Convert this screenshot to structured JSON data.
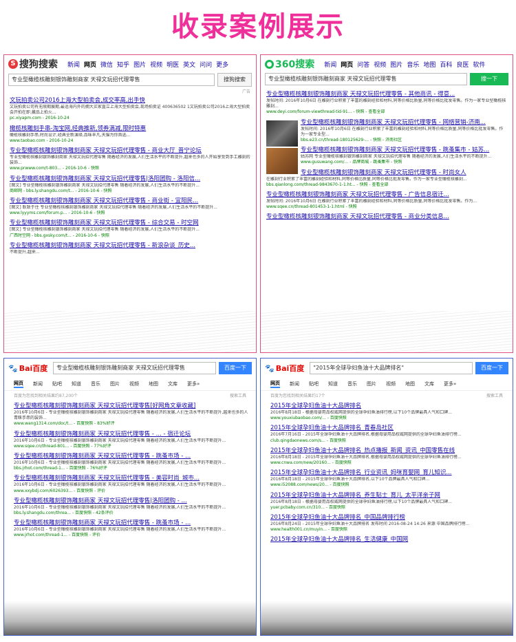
{
  "heading": "收录案例展示",
  "sogou": {
    "logo_text": "搜狗搜索",
    "nav": [
      "新闻",
      "网页",
      "微信",
      "知乎",
      "图片",
      "视频",
      "明医",
      "英文",
      "问问",
      "更多"
    ],
    "query": "专业型橄榄核雕刻银饰雕刻商家 天禄文玩招代理零售",
    "button": "搜狗搜索",
    "ad_tag": "广告",
    "results": [
      {
        "title": "文玩拍卖公司2016上海大型拍卖会,成交率高,出手快",
        "desc": "文玩拍卖公司有无限期展期,最适海内外的拥大买家直立上海大型拍卖会,现场拍卖证 400636502 1文玩拍卖公司2016上海大型拍卖会开拍在即,藏品上拍火...",
        "url": "pc.xiyapm.com - 2016-10-24"
      },
      {
        "title": "橄榄核雕刻手串-淘宝网,经典推新,领券满减,限时特惠",
        "desc": "橄榄核雕刻手串,时尚设计,经典全新演绎,品味丰凡,天猫为你首选...",
        "url": "www.taobao.com - 2016-10-24"
      },
      {
        "title": "专业型橄榄核雕刻银饰雕刻商家 天禄文玩招代理零售 - 商业大厅_普宁论坛",
        "desc": "专业型橄榄核雕刻银饰雕刻商家 天禄文玩招代理零售 随着经济的发展,人们生活水平的不断提升,越来也多的人开始享受到手工雕刻的装饰...",
        "url": "www.prwww.com/t-803... - 2016-10-6 - 快照"
      },
      {
        "title": "专业型橄榄核雕刻银饰雕刻商家 天禄文玩招代理零售|洛阳团购 - 洛阳信...",
        "desc": "[图文] 专业型橄榄核雕刻银饰雕刻商家 天禄文玩招代理零售 随着经济的发展,人们生活水平的不断提升...",
        "url": "商邮网 - bbs.ly.shangdu.com/t... - 2016-10-6 - 快照"
      },
      {
        "title": "专业型橄榄核雕刻银饰雕刻商家 天禄文玩招代理零售 - 商业街 - 宜阳民...",
        "desc": "[图文] 耿致于住 专业型橄榄核雕刻银饰雕刻商家 天禄文玩招代理零售 随着经济的发展,人们生活水平的不断提升...",
        "url": "www.lyyyms.com/forum.p... - 2016-10-6 - 快照"
      },
      {
        "title": "专业型橄榄核雕刻银饰雕刻商家 天禄文玩招代理零售 - 综合交易 - 时空网",
        "desc": "[图文] 专业型橄榄核雕刻银饰雕刻商家 天禄文玩招代理零售 随着经济的发展,人们生活水平的不断提升...",
        "url": "广西时空网 - bbs.gxsky.com/t... - 2016-10-6 - 快照"
      },
      {
        "title": "专业型橄榄核雕刻银饰雕刻商家 天禄文玩招代理零售 - 新浪杂谈_历史...",
        "desc": "不断提升,越来...",
        "url": ""
      }
    ]
  },
  "so360": {
    "logo_text": "360搜索",
    "nav": [
      "新闻",
      "网页",
      "问答",
      "视频",
      "图片",
      "音乐",
      "地图",
      "百科",
      "良医",
      "软件"
    ],
    "query": "专业型橄榄核雕刻银饰雕刻商家 天禄文玩招代理零售",
    "button": "搜一下",
    "results": [
      {
        "title": "专业型橄榄核雕刻银饰雕刻商家 天禄文玩招代理零售 - 其他商讯 - 得意...",
        "desc": "发帖时间: 2016年10月6日 在雕刻行业积累了丰富的雕刻经验和材料,同等价格比质量,同等价格比批发零售。作为一家专业型橄榄核雕刻...",
        "url": "www.deyi.com/forum-viewthread-tid-91... - 快照 - 查看全部"
      },
      {
        "title": "专业型橄榄核雕刻银饰雕刻商家 天禄文玩招代理零售 - 网络营销-济南...",
        "desc": "发帖时间: 2016年10月6日 在雕刻行业积累了丰富的雕刻经验和材料,同等价格比质量,同等价格比批发零售。作为一家专业型...",
        "url": "bbs.e23.cn/thread-180125629-... - 快照 - 济南社区"
      },
      {
        "title": "专业型橄榄核雕刻银饰雕刻商家 天禄文玩招代理零售 - 跳蚤集市 - 姑苏...",
        "desc": "姑苏网 专业型橄榄核雕刻银饰雕刻商家 天禄文玩招代理零售 随着经济的发展,人们生活水平的不断提升...",
        "url": "www.gusuwang.com/... - 品牌商城 - 跳蚤集市 - 快照"
      },
      {
        "title": "专业型橄榄核雕刻银饰雕刻商家 天禄文玩招代理零售 - 时尚女人",
        "desc": "在雕刻行业积累了丰富的雕刻经验和材料,同等价格比质量,同等价格比批发零售。作为一家专业型橄榄核雕刻...",
        "url": "bbs.qianlong.com/thread-9843670-1-1.ht... - 快照 - 查看全部"
      },
      {
        "title": "专业型橄榄核雕刻银饰雕刻商家 天禄文玩招代理零售 - 广告信息宿迁...",
        "desc": "发帖时间: 2016年10月6日 在雕刻行业积累了丰富的雕刻经验和材料,同等价格比质量,同等价格比批发零售。作为...",
        "url": "www.sqee.cn/thread-801453-1-1.html - 快照"
      },
      {
        "title": "专业型橄榄核雕刻银饰雕刻商家 天禄文玩招代理零售 - 商业分类信息...",
        "desc": "",
        "url": ""
      }
    ]
  },
  "baidu1": {
    "logo_text": "Bai百度",
    "query": "专业型橄榄核雕刻银饰雕刻商家 天禄文玩招代理零售",
    "button": "百度一下",
    "tabs": [
      "网页",
      "新闻",
      "贴吧",
      "知道",
      "音乐",
      "图片",
      "视频",
      "地图",
      "文库",
      "更多»"
    ],
    "stats": "百度为您找到相关结果约87,200个",
    "tool": "搜索工具",
    "results": [
      {
        "title": "专业型橄榄核雕刻银饰雕刻商家 天禄文玩招代理零售[好网角文章收藏]",
        "desc": "2016年10月6日 - 专业型橄榄核雕刻银饰雕刻商家 天禄文玩招代理零售 随着经济的发展,人们生活水平的不断提升,越来也多的人青睐手串的装饰...",
        "url": "www.wang1314.com/doc/t... - 百度快照 - 83%好评"
      },
      {
        "title": "专业型橄榄核雕刻银饰雕刻商家 天禄文玩招代理零售 - ... - 宿迁论坛",
        "desc": "2016年10月6日 - 专业型橄榄核雕刻银饰雕刻商家 天禄文玩招代理零售 随着经济的发展,人们生活水平的不断提升...",
        "url": "www.sqee.cn/thread-801... - 百度快照 - 77%好评"
      },
      {
        "title": "专业型橄榄核雕刻银饰雕刻商家 天禄文玩招代理零售 - 跳蚤市场 - ...",
        "desc": "2016年10月6日 - 专业型橄榄核雕刻银饰雕刻商家 天禄文玩招代理零售 随着经济的发展,人们生活水平的不断提升...",
        "url": "bbs.jrhot.com/thread-1... - 百度快照 - 76%好评"
      },
      {
        "title": "专业型橄榄核雕刻银饰雕刻商家 天禄文玩招代理零售 - 美容时尚_城市...",
        "desc": "2016年10月6日 - 专业型橄榄核雕刻银饰雕刻商家 天禄文玩招代理零售 随着经济的发展,人们生活水平的不断提升...",
        "url": "www.xxybdj.com/6026393... - 百度快照 - 评价"
      },
      {
        "title": "专业型橄榄核雕刻银饰雕刻商家 天禄文玩招代理零售|洛阳团购 - ...",
        "desc": "2016年10月6日 - 专业型橄榄核雕刻银饰雕刻商家 天禄文玩招代理零售 随着经济的发展,人们生活水平的不断提升...",
        "url": "bbs.ly.shangdu.com/threa... - 百度快照 - 42条评价"
      },
      {
        "title": "专业型橄榄核雕刻银饰雕刻商家 天禄文玩招代理零售 - 跳蚤市场 - ...",
        "desc": "2016年10月6日 - 专业型橄榄核雕刻银饰雕刻商家 天禄文玩招代理零售 随着经济的发展,人们生活水平的不断提升...",
        "url": "www.jrhot.com/thread-1... - 百度快照 - 评价"
      }
    ]
  },
  "baidu2": {
    "logo_text": "Bai百度",
    "query": "\"2015年全球孕妇鱼油十大品牌排名\"",
    "button": "百度一下",
    "tabs": [
      "网页",
      "新闻",
      "贴吧",
      "知道",
      "音乐",
      "图片",
      "视频",
      "地图",
      "文库",
      "更多»"
    ],
    "stats": "百度为您找到相关结果约17个",
    "tool": "搜索工具",
    "results": [
      {
        "title": "2015年全球孕妇鱼油十大品牌排名",
        "desc": "2016年8月18日 - 根据母婴用品权威网提供的全球孕妇鱼油排行榜,以下10个品牌最具人气和口碑...",
        "url": "www.youxiubaobao.com/... - 百度快照"
      },
      {
        "title": "2015年全球孕妇鱼油十大品牌排名_青春岛社区",
        "desc": "2016年7月16日 - 2015年全球孕妇鱼油十大品牌排名,根据母婴用品权威网提供的全球孕妇鱼油排行榜...",
        "url": "club.qingdaonews.com/s... - 百度快照"
      },
      {
        "title": "2015年全球孕妇鱼油十大品牌排名_热点播报_新闻_资讯_中国零售在线",
        "desc": "2016年8月18日 - 2015年全球孕妇鱼油十大品牌排名,根据母婴用品权威网提供的全球孕妇鱼油排行榜...",
        "url": "www.cnwa.com/new/20160... - 百度快照"
      },
      {
        "title": "2015年全球孕妇鱼油十大品牌排名_行业资讯_妈咪育婴网_育儿知识...",
        "desc": "2016年8月18日 - 2015年全球孕妇鱼油十大品牌排名,以下10个品牌最具人气和口碑...",
        "url": "www.i52088.com/news/20... - 百度快照"
      },
      {
        "title": "2015年全球孕妇鱼油十大品牌排名_养生贴士_育儿_太平洋亲子网",
        "desc": "2016年8月18日 - 根据母婴用品权威网提供的全球孕妇鱼油排行榜,以下10个品牌最具人气和口碑...",
        "url": "yuer.pcbaby.com.cn/310... - 百度快照"
      },
      {
        "title": "2015年全球孕妇鱼油十大品牌排名_中国品牌排行榜",
        "desc": "2016年8月24日 - 2015年全球孕妇鱼油十大品牌排名 发布时间 2016-08-24 14:26 来源 中国品牌排行榜...",
        "url": "www.health001.cn/muyin... - 百度快照"
      },
      {
        "title": "2015年全球孕妇鱼油十大品牌排名_生活健康_中国网",
        "desc": "",
        "url": ""
      }
    ]
  },
  "colors": {
    "accent": "#f0309a",
    "sogou": "#e4393c",
    "so360_green": "#19b955",
    "baidu_blue": "#3385ff",
    "link": "#1a0dab"
  }
}
